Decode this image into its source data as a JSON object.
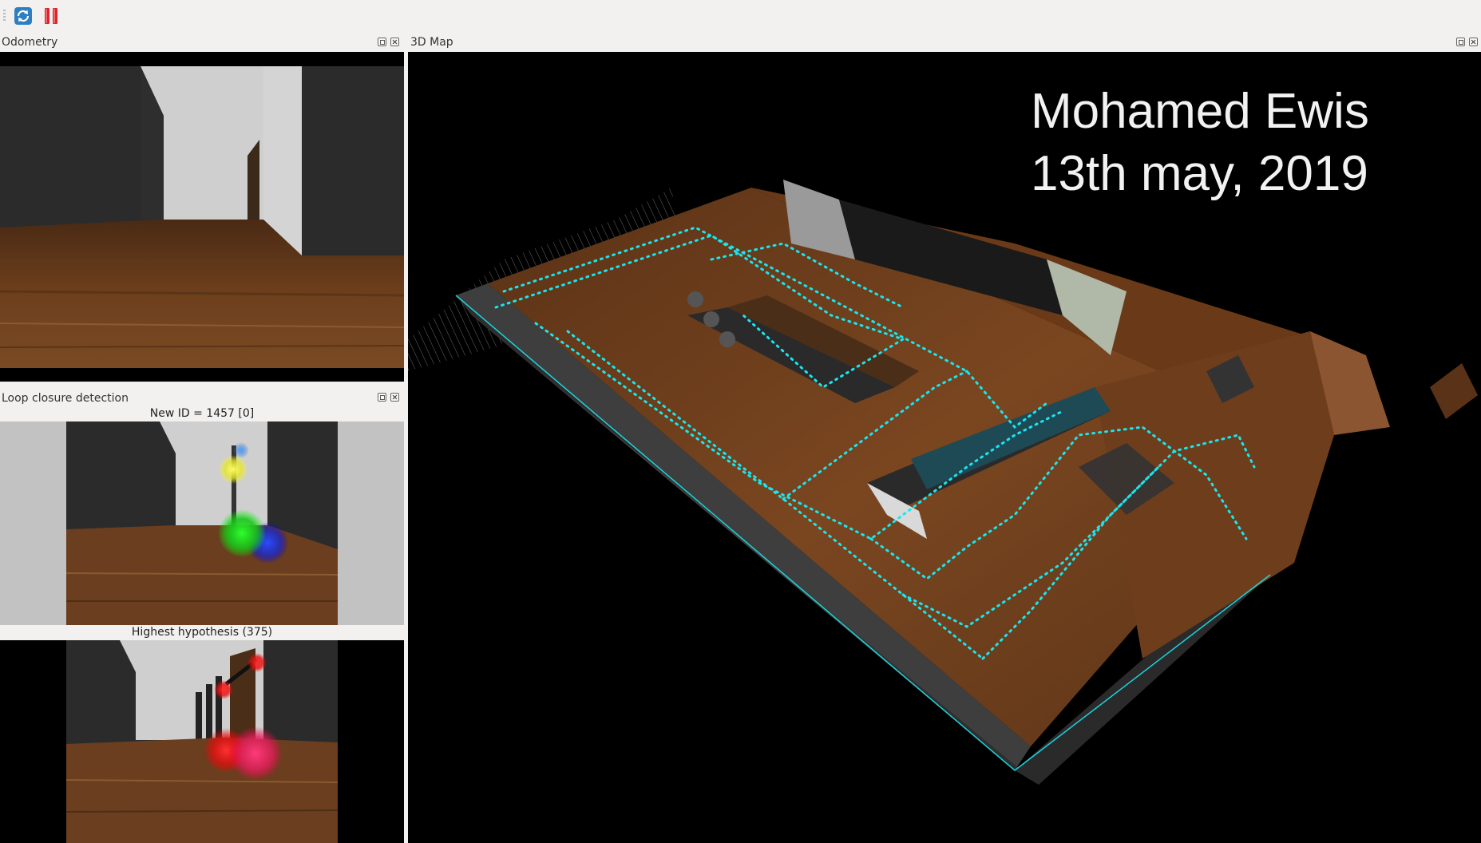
{
  "toolbar": {
    "refresh_icon": "refresh-icon",
    "pause_icon": "pause-icon"
  },
  "docks": {
    "odometry": {
      "title": "Odometry"
    },
    "map3d": {
      "title": "3D Map"
    },
    "loop_closure": {
      "title": "Loop closure detection",
      "new_id_label": "New ID = 1457 [0]",
      "hypothesis_label": "Highest hypothesis (375)"
    }
  },
  "map_overlay": {
    "line1": "Mohamed Ewis",
    "line2": "13th may, 2019"
  },
  "colors": {
    "trajectory": "#19e6f0",
    "floor": "#6b3a1a",
    "wall": "#4a4a4a",
    "background": "#000000"
  }
}
